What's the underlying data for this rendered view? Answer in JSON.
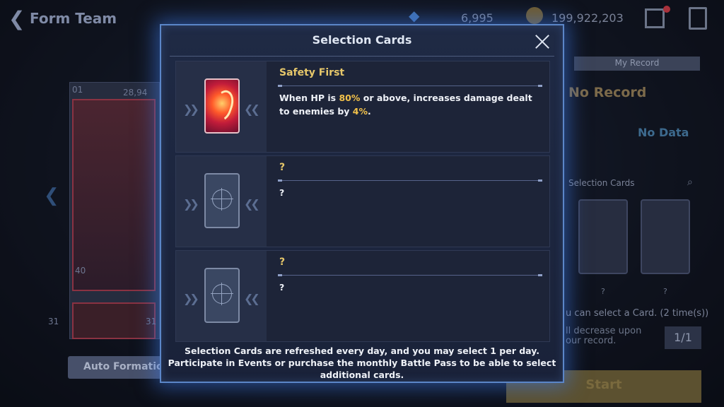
{
  "header": {
    "back_icon": "back-arrow-icon",
    "title": "Form Team",
    "gems": "6,995",
    "coins": "199,922,203"
  },
  "background": {
    "left_numbers": [
      "01",
      "28,94",
      "40",
      "31",
      "31"
    ],
    "auto_formation_label": "Auto Formatio",
    "my_record_tab": "My Record",
    "no_record": "No Record",
    "no_data": "No Data",
    "selection_cards_label": "Selection Cards",
    "slot_q": [
      "?",
      "?"
    ],
    "select_info": "u can select a Card. (2 time(s))",
    "decrease_info_1": "ll decrease upon",
    "decrease_info_2": "our record.",
    "ratio": "1/1",
    "start_label": "Start"
  },
  "modal": {
    "title": "Selection Cards",
    "cards": [
      {
        "name": "Safety First",
        "desc_parts": [
          "When HP is ",
          "80%",
          " or above, increases damage dealt to enemies by ",
          "4%",
          "."
        ],
        "known": true
      },
      {
        "name": "?",
        "desc": "?",
        "known": false
      },
      {
        "name": "?",
        "desc": "?",
        "known": false
      }
    ],
    "footer_lines": [
      "Selection Cards are refreshed every day, and you may select 1 per day.",
      "Participate in Events or purchase the monthly Battle Pass to be able to select",
      "additional cards."
    ]
  },
  "colors": {
    "accent_gold": "#e6c76a",
    "highlight": "#f2c14a",
    "modal_border": "#5b86c8"
  }
}
